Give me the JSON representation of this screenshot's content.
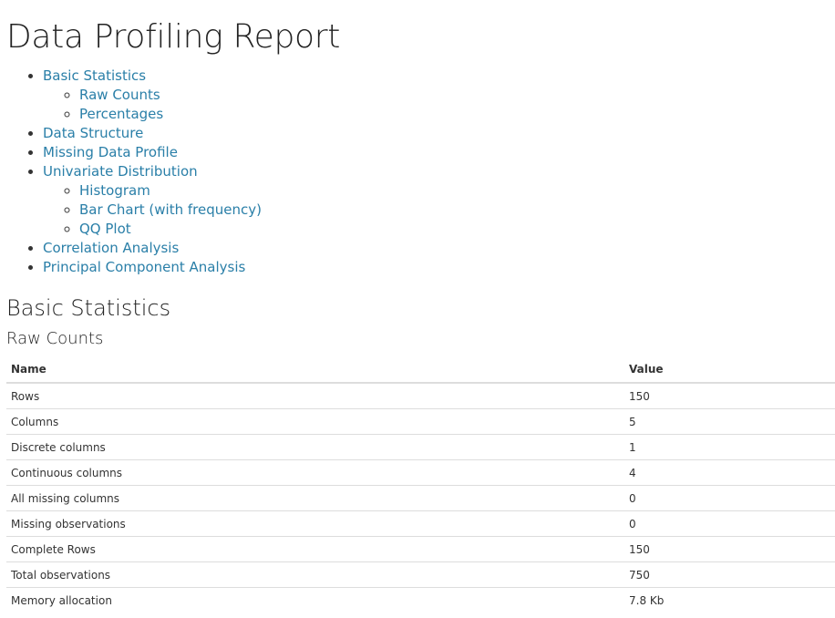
{
  "title": "Data Profiling Report",
  "toc": [
    {
      "label": "Basic Statistics",
      "children": [
        "Raw Counts",
        "Percentages"
      ]
    },
    {
      "label": "Data Structure",
      "children": []
    },
    {
      "label": "Missing Data Profile",
      "children": []
    },
    {
      "label": "Univariate Distribution",
      "children": [
        "Histogram",
        "Bar Chart (with frequency)",
        "QQ Plot"
      ]
    },
    {
      "label": "Correlation Analysis",
      "children": []
    },
    {
      "label": "Principal Component Analysis",
      "children": []
    }
  ],
  "section": {
    "title": "Basic Statistics",
    "subtitle": "Raw Counts"
  },
  "table": {
    "headers": [
      "Name",
      "Value"
    ],
    "rows": [
      [
        "Rows",
        "150"
      ],
      [
        "Columns",
        "5"
      ],
      [
        "Discrete columns",
        "1"
      ],
      [
        "Continuous columns",
        "4"
      ],
      [
        "All missing columns",
        "0"
      ],
      [
        "Missing observations",
        "0"
      ],
      [
        "Complete Rows",
        "150"
      ],
      [
        "Total observations",
        "750"
      ],
      [
        "Memory allocation",
        "7.8 Kb"
      ]
    ]
  },
  "colors": {
    "link": "#2a7fa8",
    "text": "#333333",
    "rule": "#dddddd"
  }
}
